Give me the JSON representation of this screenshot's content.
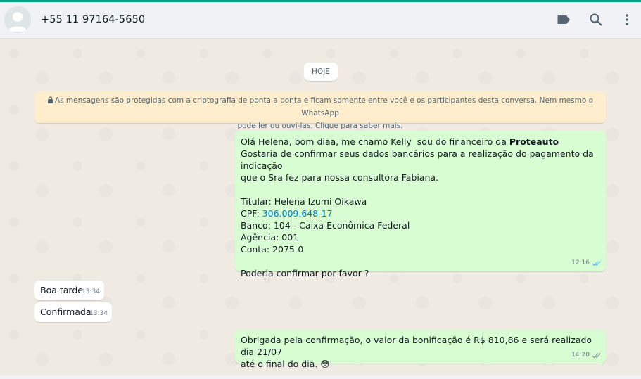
{
  "header": {
    "contact_name": "+55 11 97164-5650",
    "icons": [
      "label-icon",
      "search-icon",
      "menu-icon"
    ]
  },
  "chat": {
    "date_chip": "HOJE",
    "encryption_notice_line1": "As mensagens são protegidas com a criptografia de ponta a ponta e ficam somente entre você e os participantes desta conversa. Nem mesmo o WhatsApp",
    "encryption_notice_line2": "pode ler ou ouvi-las. Clique para saber mais.",
    "messages": [
      {
        "direction": "outgoing",
        "line1_prefix": "Olá Helena, bom diaa, me chamo Kelly  sou do financeiro da ",
        "line1_bold": "Proteauto",
        "line2": "Gostaria de confirmar seus dados bancários para a realização do pagamento da indicação",
        "line3": "que o Sra fez para nossa consultora Fabiana.",
        "titular": "Titular: Helena Izumi Oikawa",
        "cpf_label": "CPF: ",
        "cpf_value": "306.009.648-17",
        "banco": "Banco: 104 - Caixa Econômica Federal",
        "agencia": "Agência: 001",
        "conta": "Conta: 2075-0",
        "closing": "Poderia confirmar por favor ?",
        "time": "12:16",
        "status": "read"
      },
      {
        "direction": "incoming",
        "text": "Boa tarde",
        "time": "13:34"
      },
      {
        "direction": "incoming",
        "text": "Confirmada",
        "time": "13:34"
      },
      {
        "direction": "outgoing",
        "line1": "Obrigada pela confirmação, o valor da bonificação é R$ 810,86 e será realizado dia 21/07",
        "line2": "até o final do dia.",
        "emoji": "😳",
        "time": "14:20",
        "status": "delivered"
      }
    ]
  },
  "colors": {
    "accent": "#00a884",
    "outgoing_bubble": "#d9fdd3",
    "incoming_bubble": "#ffffff",
    "notice_bg": "#ffeecd",
    "read_tick": "#53bdeb",
    "link": "#027eb5"
  }
}
